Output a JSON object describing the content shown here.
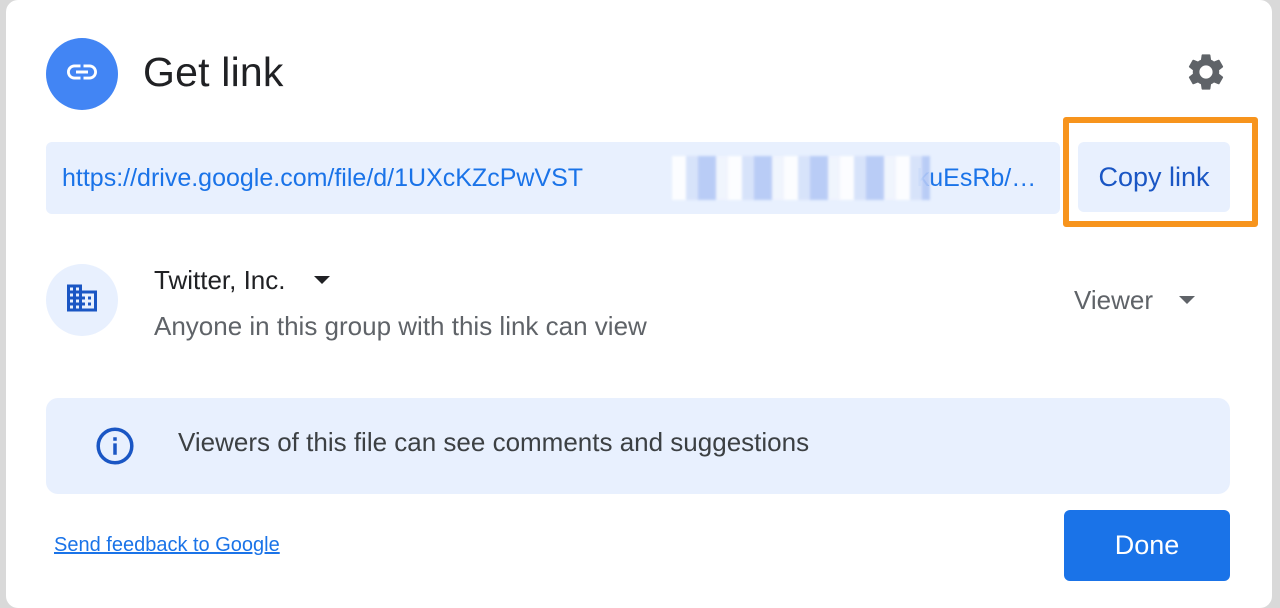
{
  "dialog": {
    "title": "Get link",
    "link_icon": "link-icon",
    "settings_icon": "gear-icon"
  },
  "link": {
    "url": "https://drive.google.com/file/d/1UXcKZcPwVST                        kuEsRb/…",
    "copy_label": "Copy link"
  },
  "access": {
    "group_icon": "building-icon",
    "group_name": "Twitter, Inc.",
    "description": "Anyone in this group with this link can view",
    "role": "Viewer"
  },
  "info": {
    "icon": "info-icon",
    "text": "Viewers of this file can see comments and suggestions"
  },
  "footer": {
    "feedback_label": "Send feedback to Google",
    "done_label": "Done"
  },
  "colors": {
    "accent": "#1a73e8",
    "highlight": "#f7941d",
    "banner": "#e8f0fe"
  }
}
